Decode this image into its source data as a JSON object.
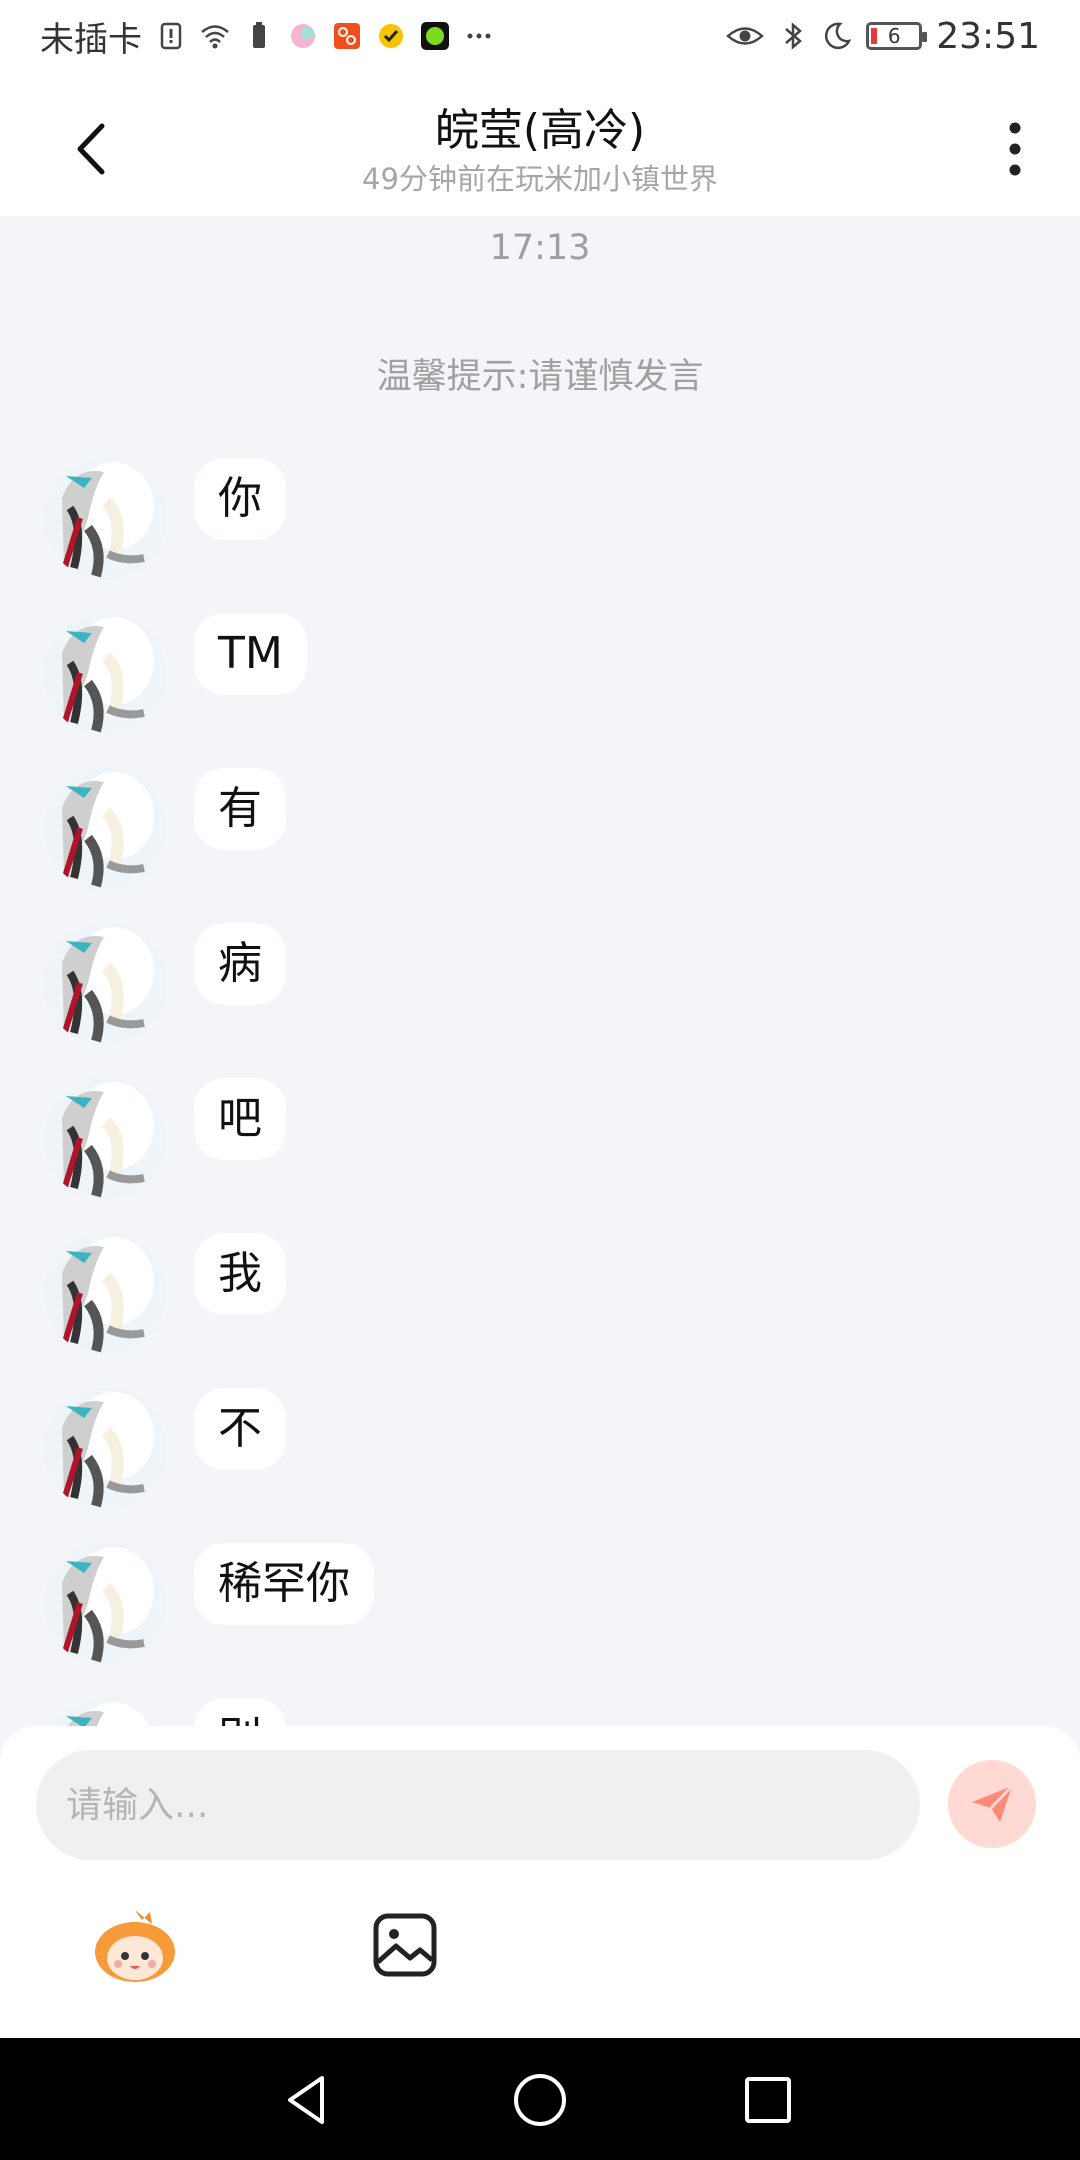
{
  "status_bar": {
    "carrier": "未插卡",
    "time": "23:51",
    "battery": "6",
    "left_icons": [
      "sim-alert-icon",
      "wifi-icon",
      "battery-saver-icon",
      "app-icon-1",
      "app-icon-2",
      "app-icon-3",
      "app-icon-4",
      "more-dots-icon"
    ],
    "right_icons": [
      "eye-icon",
      "bluetooth-icon",
      "moon-icon",
      "battery-icon"
    ]
  },
  "header": {
    "title": "皖莹(高冷)",
    "subtitle": "49分钟前在玩米加小镇世界",
    "back_icon": "chevron-left-icon",
    "more_icon": "more-vertical-icon"
  },
  "chat": {
    "timestamp": "17:13",
    "tip": "温馨提示:请谨慎发言",
    "messages": [
      {
        "text": "你"
      },
      {
        "text": "TM"
      },
      {
        "text": "有"
      },
      {
        "text": "病"
      },
      {
        "text": "吧"
      },
      {
        "text": "我"
      },
      {
        "text": "不"
      },
      {
        "text": "稀罕你"
      },
      {
        "text": "别"
      }
    ]
  },
  "input": {
    "placeholder": "请输入...",
    "send_icon": "send-icon",
    "emoji_icon": "emoji-mascot-icon",
    "image_icon": "image-icon"
  },
  "colors": {
    "background": "#f3f5f9",
    "send_button": "#ffd9d3",
    "send_arrow": "#ff8a75",
    "nav_bar": "#000000"
  }
}
